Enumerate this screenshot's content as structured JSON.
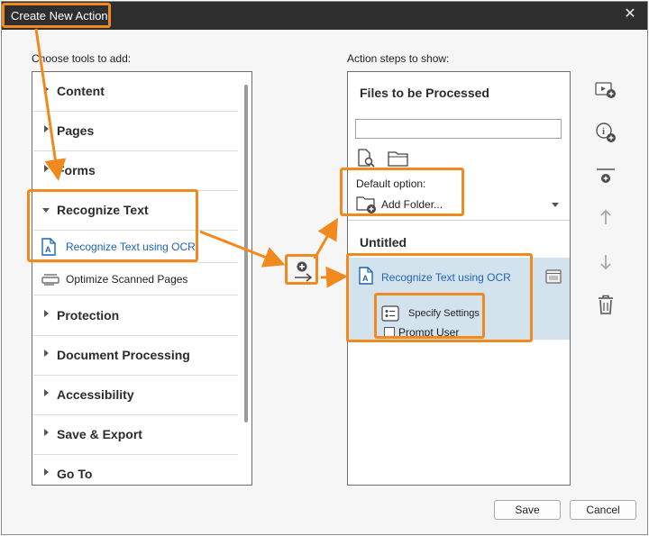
{
  "window": {
    "title": "Create New Action",
    "close_glyph": "✕"
  },
  "left": {
    "label": "Choose tools to add:",
    "categories": [
      {
        "label": "Content",
        "expanded": false
      },
      {
        "label": "Pages",
        "expanded": false
      },
      {
        "label": "Forms",
        "expanded": false
      },
      {
        "label": "Recognize Text",
        "expanded": true
      },
      {
        "label": "Protection",
        "expanded": false
      },
      {
        "label": "Document Processing",
        "expanded": false
      },
      {
        "label": "Accessibility",
        "expanded": false
      },
      {
        "label": "Save & Export",
        "expanded": false
      },
      {
        "label": "Go To",
        "expanded": false
      }
    ],
    "sub_items": [
      {
        "label": "Recognize Text using OCR",
        "icon": "pdf-ocr-icon"
      },
      {
        "label": "Optimize Scanned Pages",
        "icon": "scanner-icon"
      }
    ]
  },
  "right": {
    "label": "Action steps to show:",
    "files_heading": "Files to be Processed",
    "files_input_value": "",
    "default_option_label": "Default option:",
    "add_folder_label": "Add Folder...",
    "untitled_heading": "Untitled",
    "step": {
      "label": "Recognize Text using OCR",
      "specify_settings": "Specify Settings",
      "prompt_user": "Prompt User"
    }
  },
  "side_icons": [
    "insert-instruction-icon",
    "add-info-icon",
    "insert-divider-icon",
    "move-up-icon",
    "move-down-icon",
    "delete-icon"
  ],
  "buttons": {
    "save": "Save",
    "cancel": "Cancel"
  },
  "colors": {
    "accent": "#f18a1e",
    "link_blue": "#1e64b4",
    "selected_row": "#d3e3ee",
    "titlebar": "#2f2f2f"
  }
}
